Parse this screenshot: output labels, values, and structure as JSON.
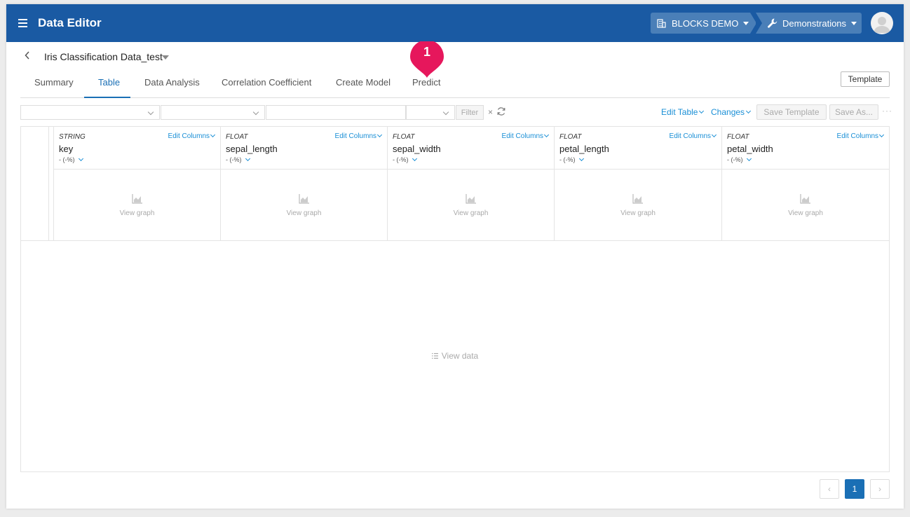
{
  "header": {
    "app_title": "Data Editor",
    "org_label": "BLOCKS DEMO",
    "workspace_label": "Demonstrations"
  },
  "dataset": {
    "title": "Iris Classification Data_test"
  },
  "tabs": [
    {
      "label": "Summary",
      "active": false
    },
    {
      "label": "Table",
      "active": true
    },
    {
      "label": "Data Analysis",
      "active": false
    },
    {
      "label": "Correlation Coefficient",
      "active": false
    },
    {
      "label": "Create Model",
      "active": false
    },
    {
      "label": "Predict",
      "active": false
    }
  ],
  "step_marker": "1",
  "template_button": "Template",
  "toolbar": {
    "filter_label": "Filter",
    "clear_label": "×",
    "edit_table": "Edit Table",
    "changes": "Changes",
    "save_template": "Save Template",
    "save_as": "Save As...",
    "more": "···"
  },
  "columns": [
    {
      "type": "STRING",
      "name": "key",
      "pct": "- (-%)",
      "edit": "Edit Columns",
      "graph": "View graph"
    },
    {
      "type": "FLOAT",
      "name": "sepal_length",
      "pct": "- (-%)",
      "edit": "Edit Columns",
      "graph": "View graph"
    },
    {
      "type": "FLOAT",
      "name": "sepal_width",
      "pct": "- (-%)",
      "edit": "Edit Columns",
      "graph": "View graph"
    },
    {
      "type": "FLOAT",
      "name": "petal_length",
      "pct": "- (-%)",
      "edit": "Edit Columns",
      "graph": "View graph"
    },
    {
      "type": "FLOAT",
      "name": "petal_width",
      "pct": "- (-%)",
      "edit": "Edit Columns",
      "graph": "View graph"
    }
  ],
  "view_data_label": "View data",
  "pagination": {
    "prev": "‹",
    "current": "1",
    "next": "›"
  },
  "colors": {
    "header_bg": "#1a5aa3",
    "accent": "#1a6fb5",
    "link": "#1a8fd6",
    "marker": "#e6175c"
  },
  "icons": {
    "menu": "hamburger-icon",
    "org": "building-icon",
    "workspace": "wrench-icon",
    "back": "chevron-left-icon",
    "refresh": "refresh-icon",
    "graph": "area-chart-icon",
    "list": "list-icon"
  }
}
